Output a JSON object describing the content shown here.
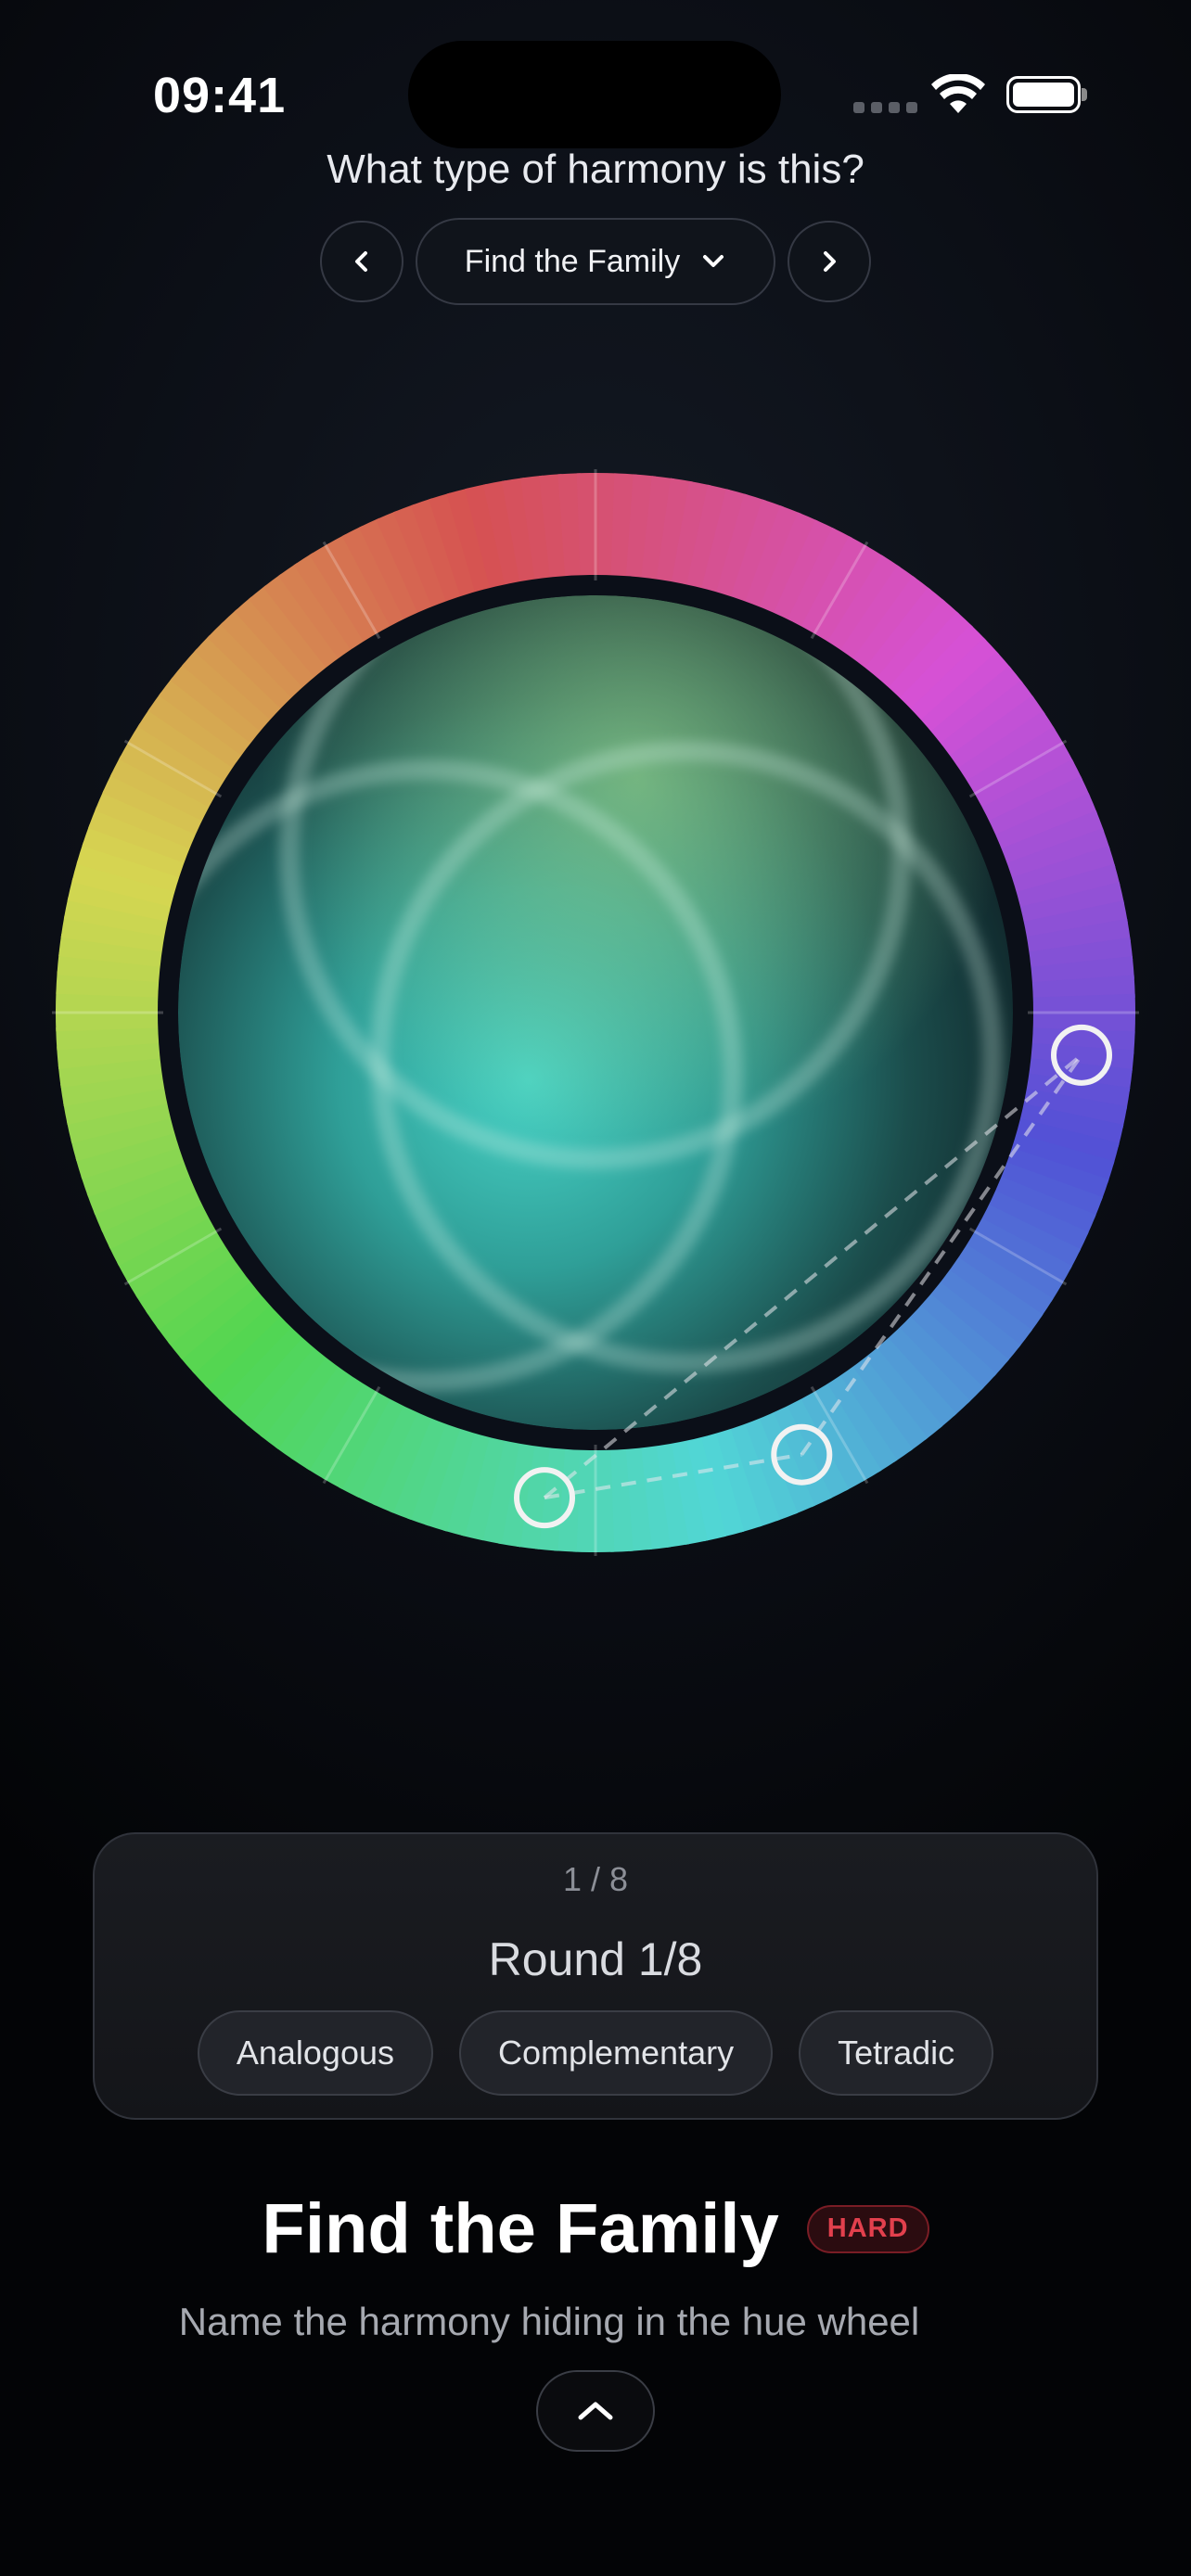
{
  "status_bar": {
    "time": "09:41"
  },
  "header": {
    "question": "What type of harmony is this?",
    "mode_label": "Find the Family",
    "prev_icon": "chevron-left-icon",
    "next_icon": "chevron-right-icon",
    "dropdown_icon": "chevron-down-icon"
  },
  "wheel": {
    "markers": [
      {
        "label": "marker-1",
        "hue_deg": 186
      },
      {
        "label": "marker-2",
        "hue_deg": 155
      },
      {
        "label": "marker-3",
        "hue_deg": 95
      }
    ]
  },
  "round_card": {
    "counter": "1 / 8",
    "round_label": "Round 1/8",
    "options": [
      "Analogous",
      "Complementary",
      "Tetradic"
    ]
  },
  "footer": {
    "title": "Find the Family",
    "difficulty": "HARD",
    "subtitle": "Name the harmony hiding in the hue wheel",
    "expand_icon": "chevron-up-icon"
  },
  "colors": {
    "accent_hard": "#e2404d",
    "background": "#0b0e15"
  }
}
